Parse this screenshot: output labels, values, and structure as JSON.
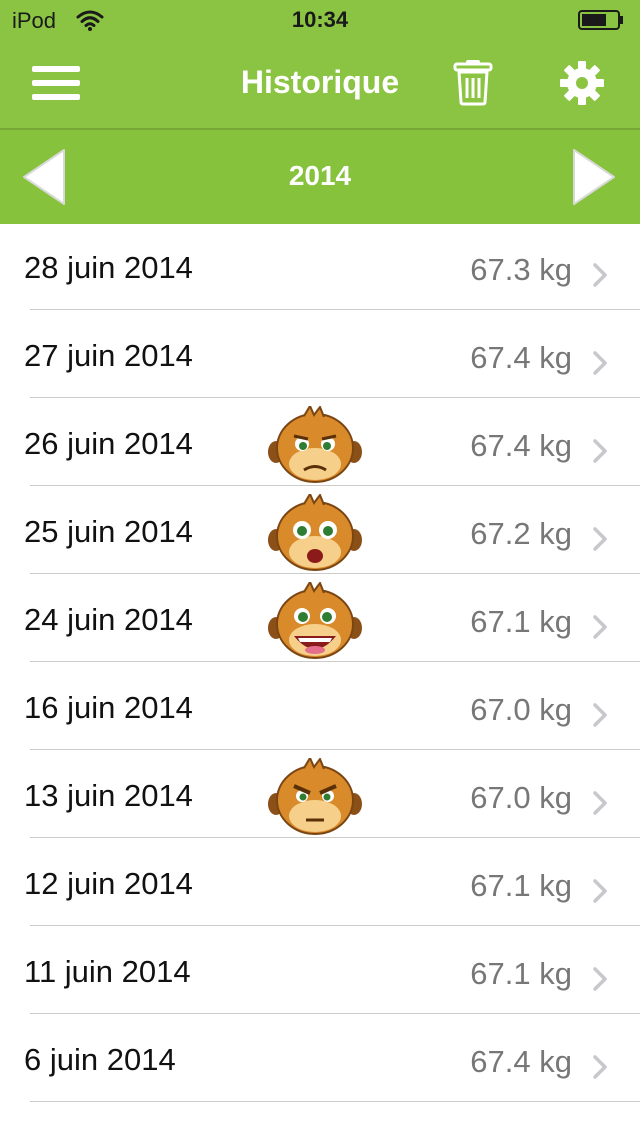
{
  "status_bar": {
    "carrier": "iPod",
    "time": "10:34"
  },
  "nav": {
    "title": "Historique"
  },
  "year_selector": {
    "year": "2014"
  },
  "colors": {
    "header": "#8bc443",
    "year_bar": "#86c23b"
  },
  "entries": [
    {
      "date": "28 juin 2014",
      "weight": "67.3 kg",
      "mood": null
    },
    {
      "date": "27 juin 2014",
      "weight": "67.4 kg",
      "mood": null
    },
    {
      "date": "26 juin 2014",
      "weight": "67.4 kg",
      "mood": "sad-face-icon"
    },
    {
      "date": "25 juin 2014",
      "weight": "67.2 kg",
      "mood": "surprised-face-icon"
    },
    {
      "date": "24 juin 2014",
      "weight": "67.1 kg",
      "mood": "happy-face-icon"
    },
    {
      "date": "16 juin 2014",
      "weight": "67.0 kg",
      "mood": null
    },
    {
      "date": "13 juin 2014",
      "weight": "67.0 kg",
      "mood": "angry-face-icon"
    },
    {
      "date": "12 juin 2014",
      "weight": "67.1 kg",
      "mood": null
    },
    {
      "date": "11 juin 2014",
      "weight": "67.1 kg",
      "mood": null
    },
    {
      "date": "6 juin 2014",
      "weight": "67.4 kg",
      "mood": null
    }
  ]
}
